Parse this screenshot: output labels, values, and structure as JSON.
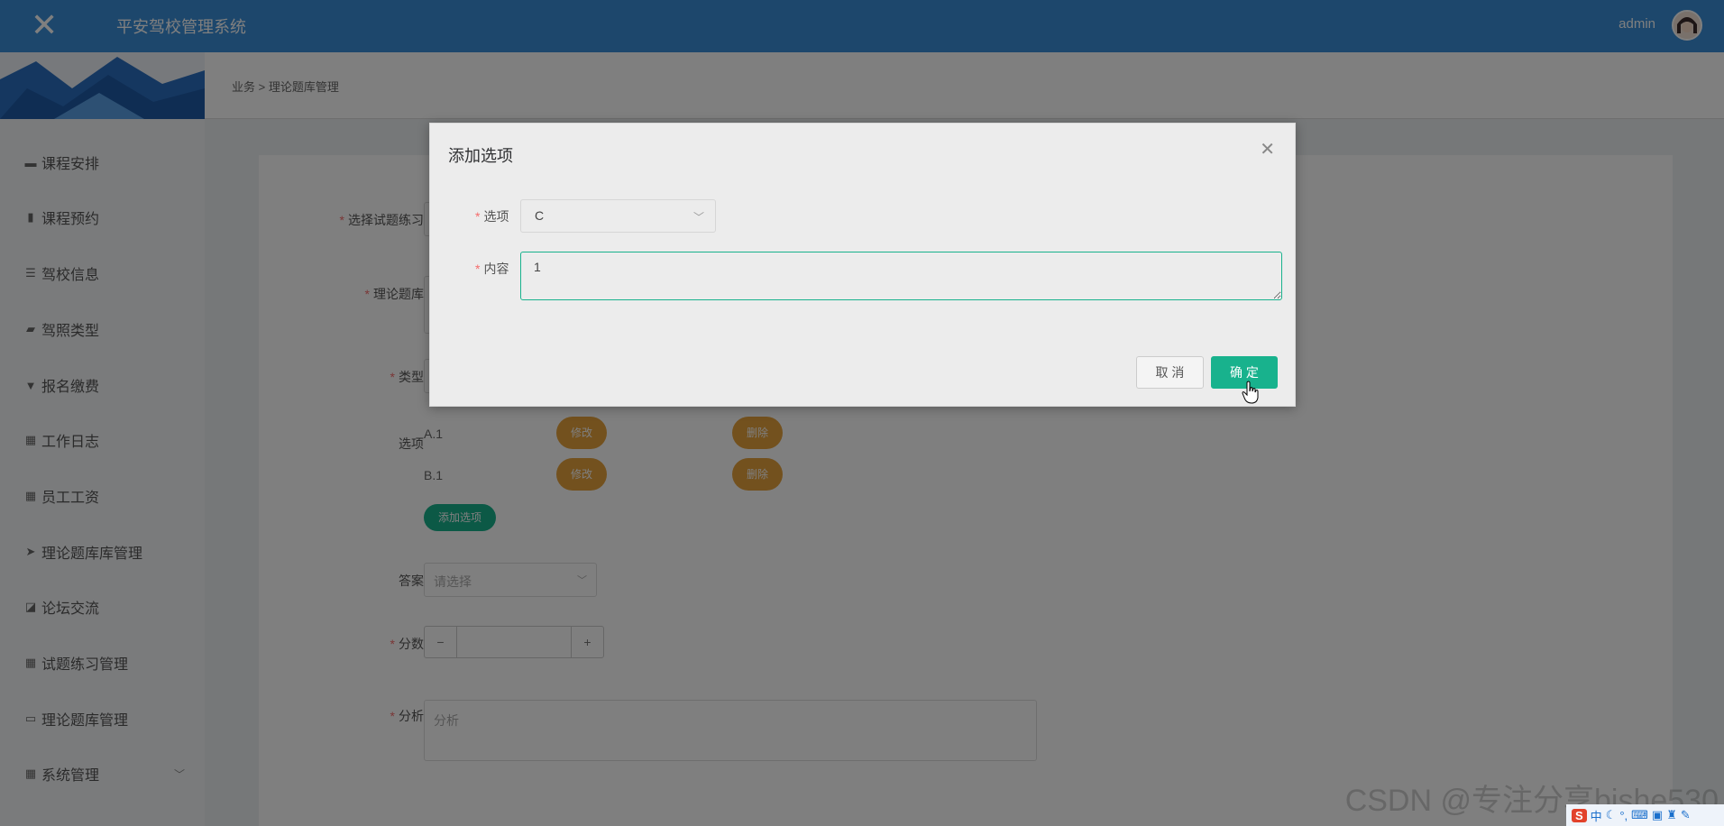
{
  "header": {
    "title": "平安驾校管理系统",
    "user": "admin"
  },
  "breadcrumb": "业务 > 理论题库管理",
  "sidebar": {
    "items": [
      {
        "label": "课程安排",
        "icon": "ticket-icon"
      },
      {
        "label": "课程预约",
        "icon": "bar-chart-icon"
      },
      {
        "label": "驾校信息",
        "icon": "list-icon"
      },
      {
        "label": "驾照类型",
        "icon": "comment-icon"
      },
      {
        "label": "报名缴费",
        "icon": "trophy-icon"
      },
      {
        "label": "工作日志",
        "icon": "grid-icon"
      },
      {
        "label": "员工工资",
        "icon": "grid-icon"
      },
      {
        "label": "理论题库库管理",
        "icon": "send-icon"
      },
      {
        "label": "论坛交流",
        "icon": "line-chart-icon"
      },
      {
        "label": "试题练习管理",
        "icon": "grid-icon"
      },
      {
        "label": "理论题库管理",
        "icon": "monitor-icon"
      },
      {
        "label": "系统管理",
        "icon": "grid-icon"
      }
    ]
  },
  "form": {
    "practice_label": "选择试题练习",
    "bank_label": "理论题库",
    "type_label": "类型",
    "options_label": "选项",
    "options": [
      {
        "text": "A.1",
        "edit": "修改",
        "delete": "删除"
      },
      {
        "text": "B.1",
        "edit": "修改",
        "delete": "删除"
      }
    ],
    "add_option": "添加选项",
    "answer_label": "答案",
    "answer_placeholder": "请选择",
    "score_label": "分数",
    "minus": "−",
    "plus": "+",
    "analysis_label": "分析",
    "analysis_placeholder": "分析"
  },
  "dialog": {
    "title": "添加选项",
    "option_label": "选项",
    "option_value": "C",
    "content_label": "内容",
    "content_value": "1",
    "cancel": "取 消",
    "confirm": "确 定"
  },
  "watermark": "CSDN @专注分享bishe530",
  "tray": {
    "ime": "S",
    "lang": "中"
  },
  "colors": {
    "header": "#3a8fd9",
    "primary": "#18b28d",
    "warning": "#e6a23c",
    "required": "#f56c6c"
  }
}
